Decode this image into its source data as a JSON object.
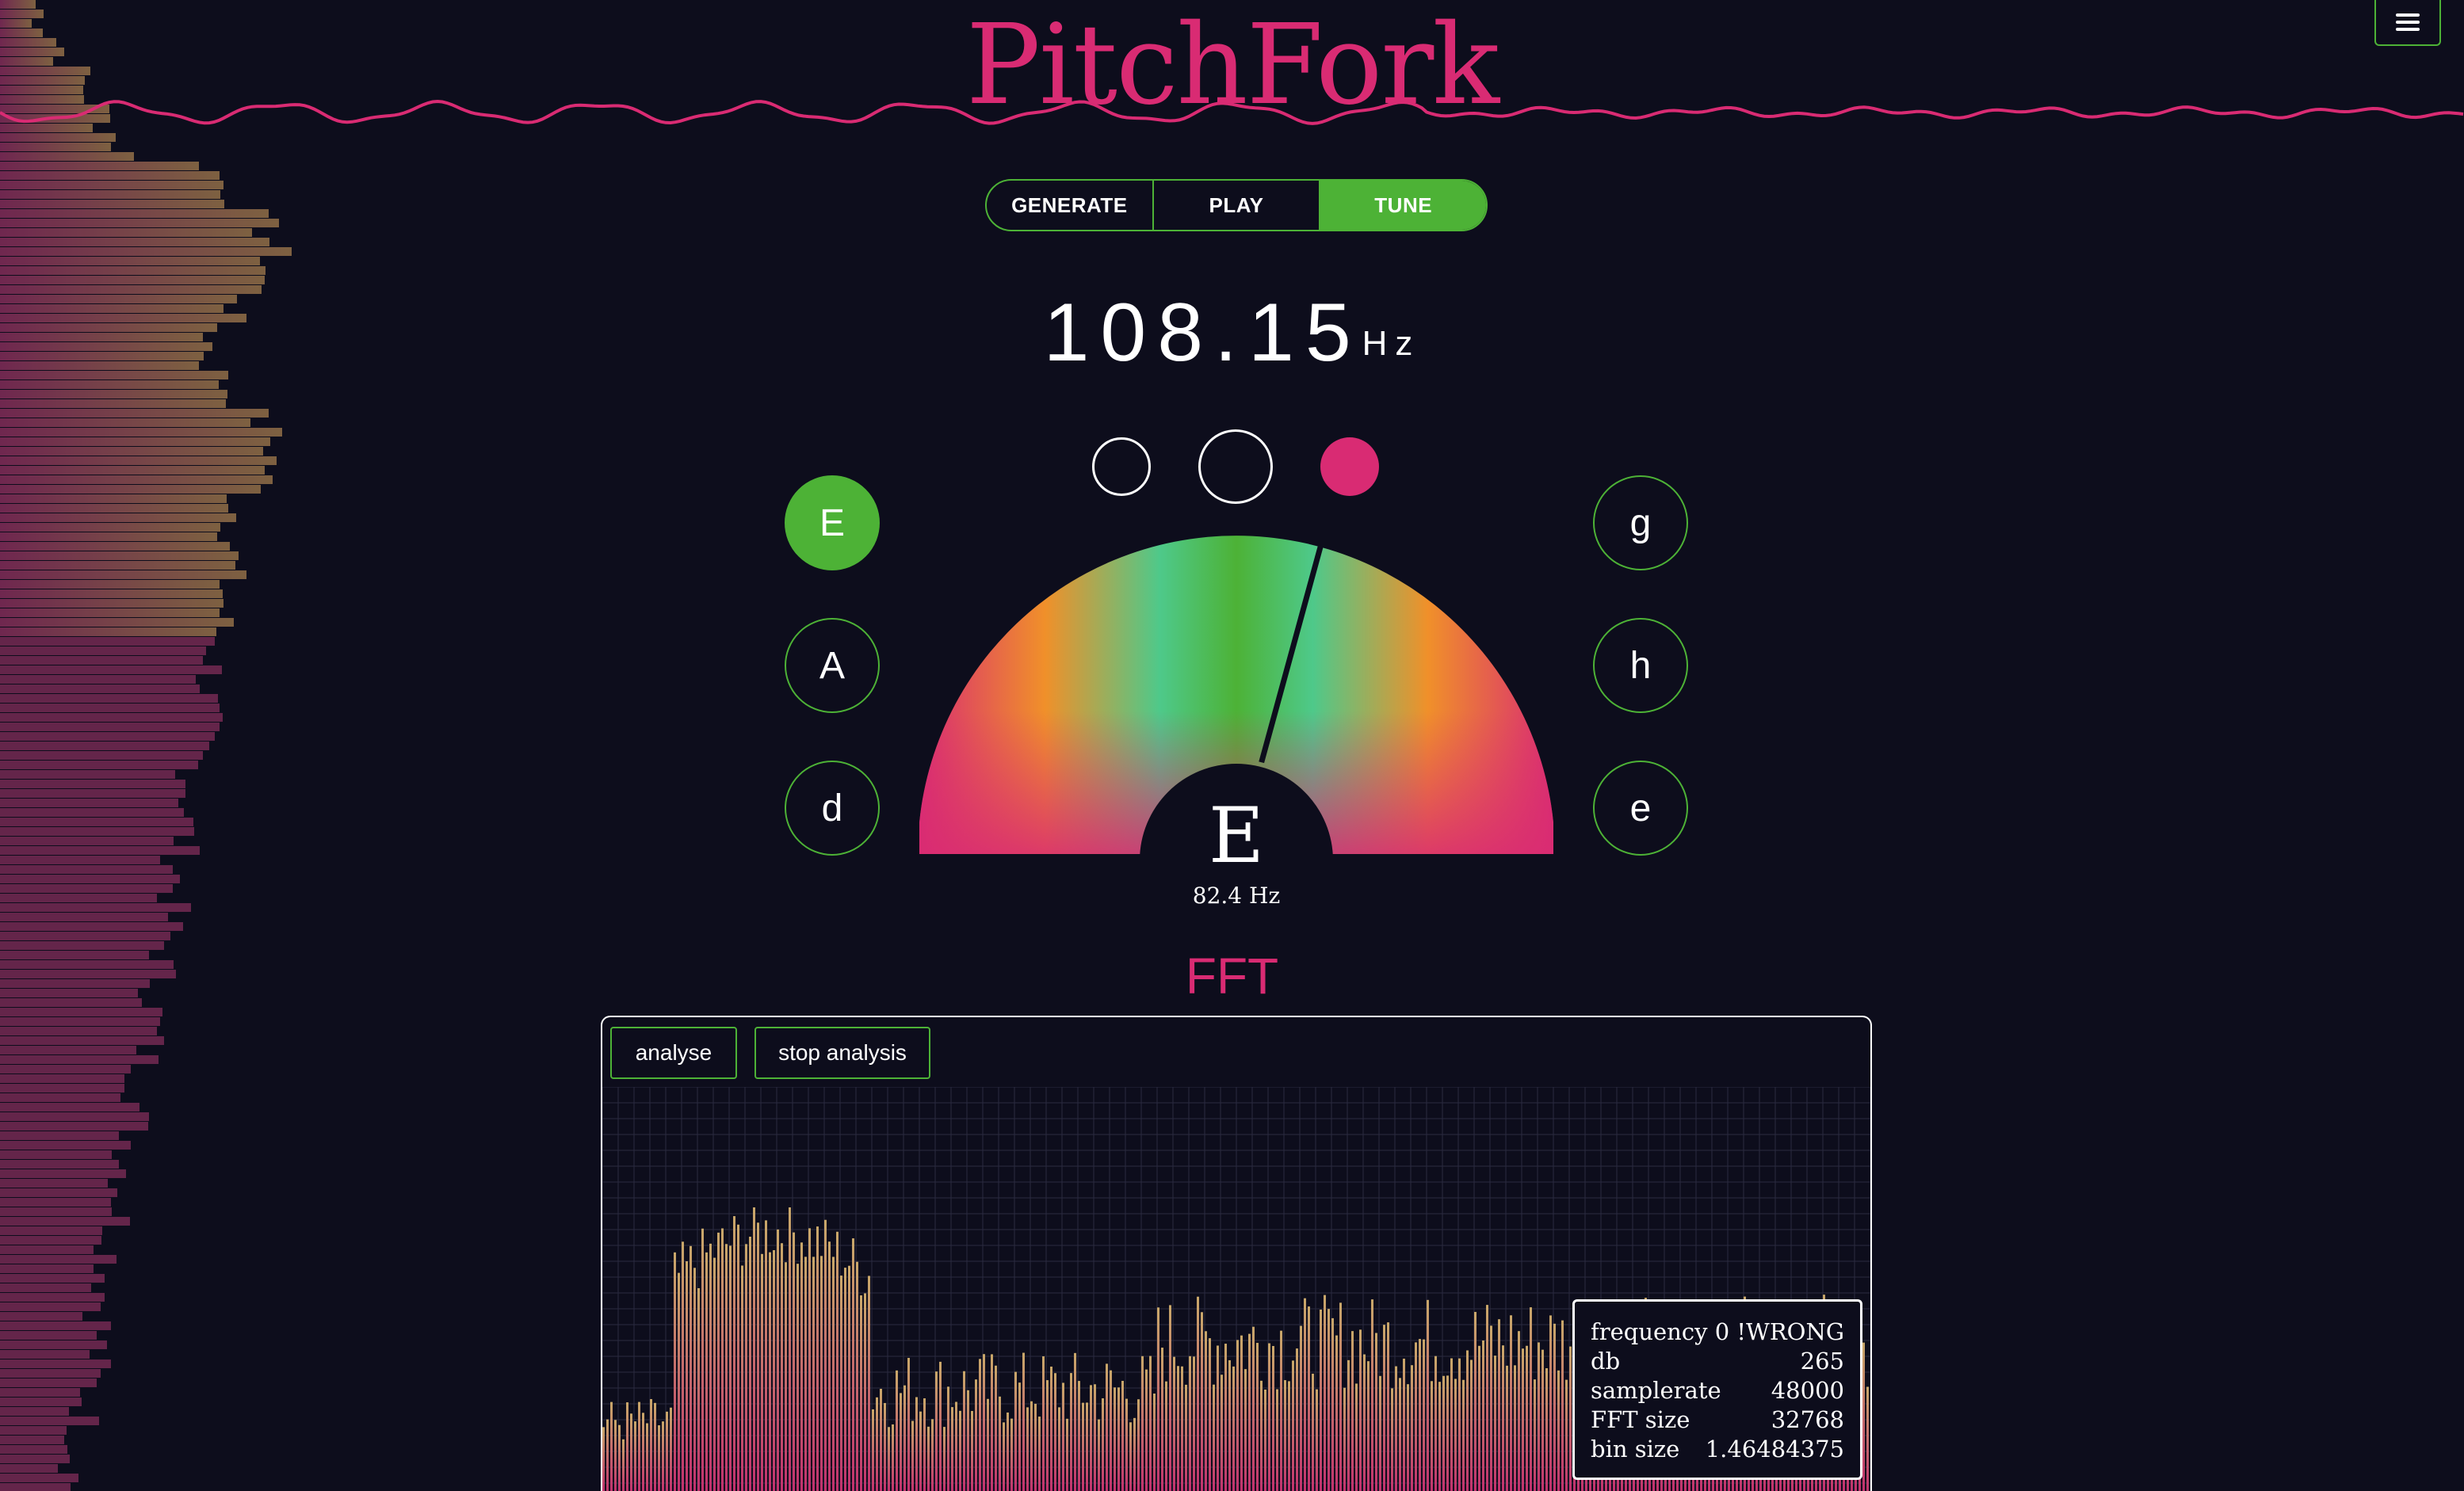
{
  "app": {
    "title": "PitchFork"
  },
  "modes": [
    {
      "label": "GENERATE",
      "active": false
    },
    {
      "label": "PLAY",
      "active": false
    },
    {
      "label": "TUNE",
      "active": true
    }
  ],
  "tuner": {
    "frequency": "108.15",
    "frequency_unit": "Hz",
    "note": "E",
    "note_frequency": "82.4 Hz",
    "pitch_state": "sharp",
    "needle_cents_fraction": 0.17
  },
  "strings_left": [
    "E",
    "A",
    "d"
  ],
  "strings_right": [
    "g",
    "h",
    "e"
  ],
  "active_string": "E",
  "fft": {
    "title": "FFT",
    "analyse_label": "analyse",
    "stop_label": "stop analysis",
    "info": [
      {
        "label": "frequency",
        "value": "0 !WRONG"
      },
      {
        "label": "db",
        "value": "265"
      },
      {
        "label": "samplerate",
        "value": "48000"
      },
      {
        "label": "FFT size",
        "value": "32768"
      },
      {
        "label": "bin size",
        "value": "1.46484375"
      }
    ]
  },
  "colors": {
    "accent_green": "#4db236",
    "accent_pink": "#d92b73",
    "background": "#0d0d1c",
    "gauge_orange": "#f0902a",
    "gauge_teal": "#4ec98a"
  },
  "icons": {
    "menu": "hamburger-icon"
  }
}
